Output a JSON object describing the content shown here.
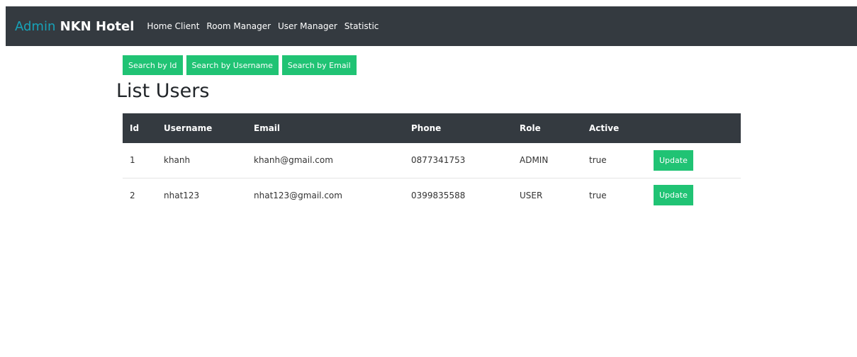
{
  "nav": {
    "brand_accent": "Admin",
    "brand_main": "NKN Hotel",
    "links": [
      "Home Client",
      "Room Manager",
      "User Manager",
      "Statistic"
    ]
  },
  "search": {
    "by_id": "Search by Id",
    "by_username": "Search by Username",
    "by_email": "Search by Email"
  },
  "page": {
    "title": "List Users"
  },
  "table": {
    "headers": [
      "Id",
      "Username",
      "Email",
      "Phone",
      "Role",
      "Active"
    ],
    "rows": [
      {
        "id": "1",
        "username": "khanh",
        "email": "khanh@gmail.com",
        "phone": "0877341753",
        "role": "ADMIN",
        "active": "true",
        "action": "Update"
      },
      {
        "id": "2",
        "username": "nhat123",
        "email": "nhat123@gmail.com",
        "phone": "0399835588",
        "role": "USER",
        "active": "true",
        "action": "Update"
      }
    ]
  },
  "colors": {
    "navbar": "#343a40",
    "brand_accent": "#17a2b8",
    "button_green": "#20c374"
  }
}
